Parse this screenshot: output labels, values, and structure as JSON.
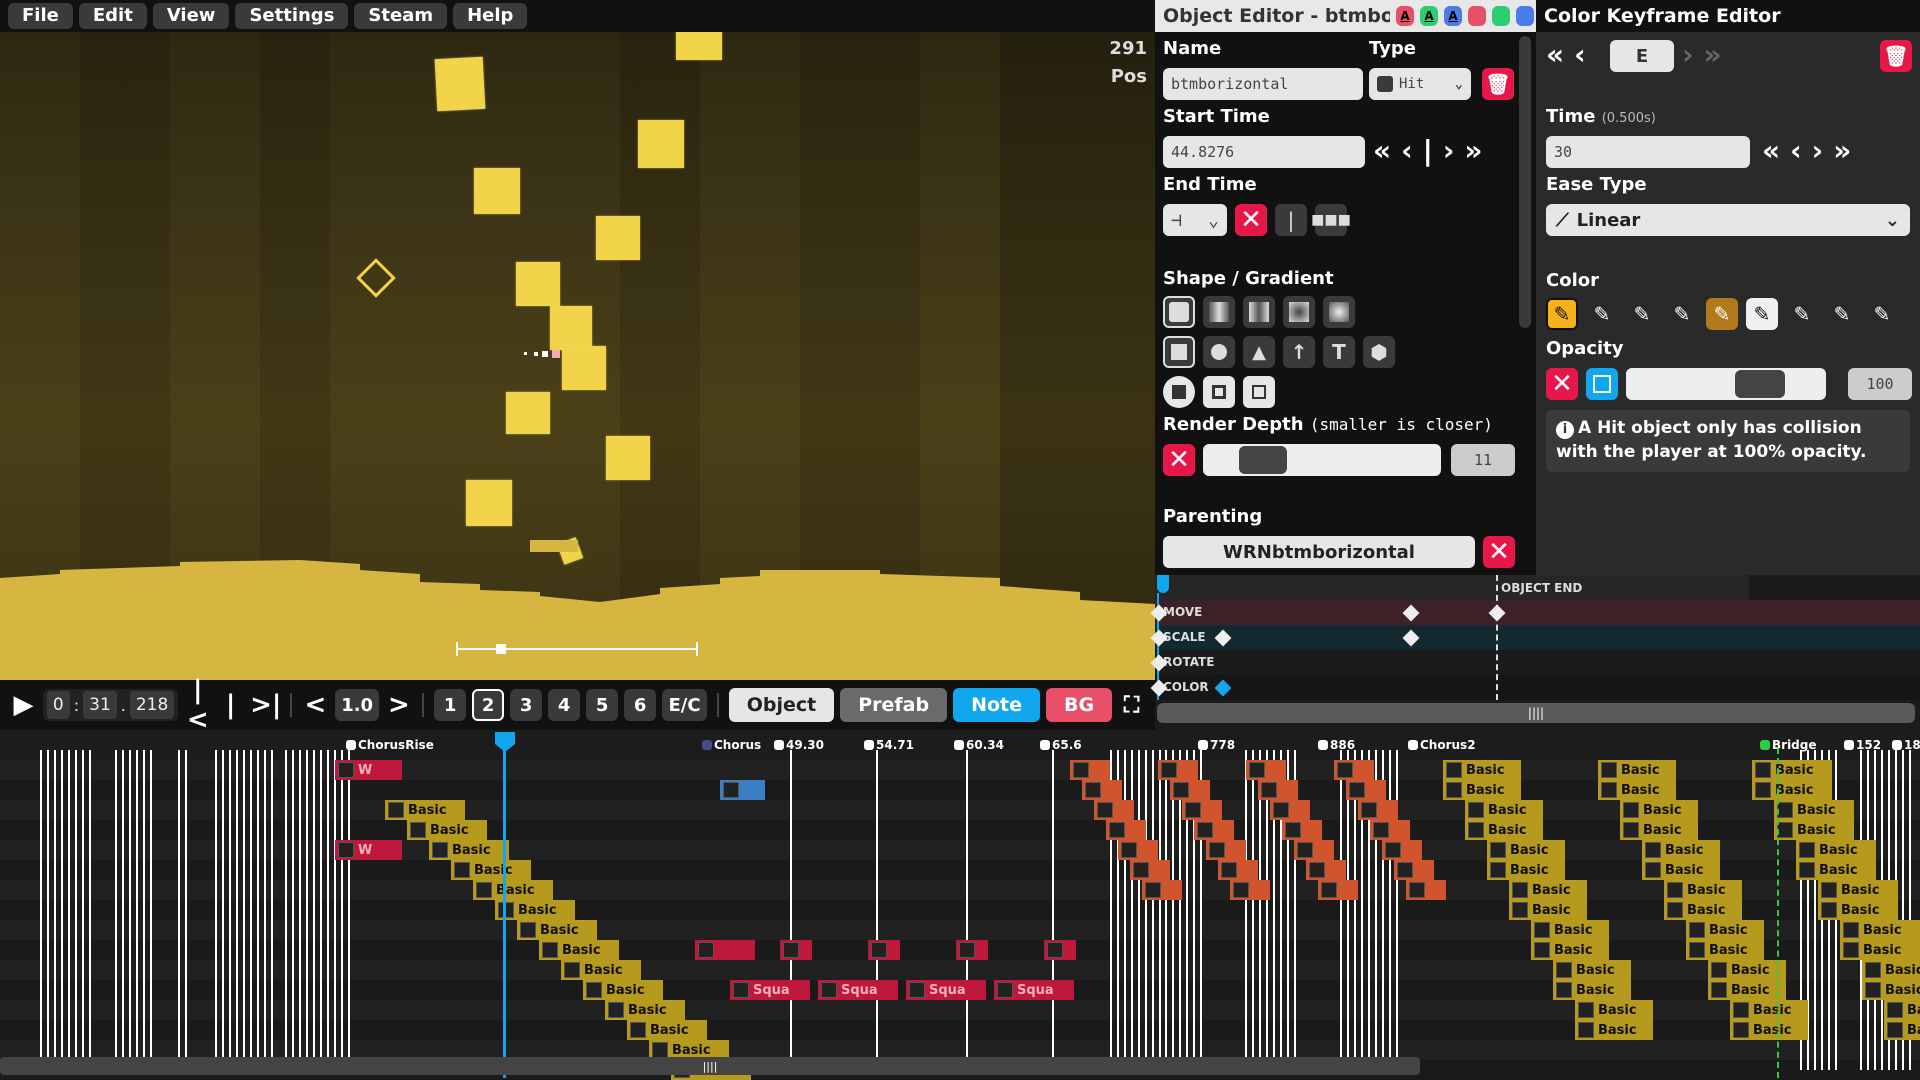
{
  "menu": [
    "File",
    "Edit",
    "View",
    "Settings",
    "Steam",
    "Help"
  ],
  "viewport": {
    "top_right_value": "291",
    "top_right_label": "Pos",
    "colors": {
      "object": "#f2d44a",
      "background": "#3d3516"
    }
  },
  "playbar": {
    "play_icon": "play-icon",
    "time": {
      "minutes": "0",
      "seconds": "31",
      "millis": "218",
      "sep1": ":",
      "sep2": "."
    },
    "speed": "1.0",
    "layers": [
      "1",
      "2",
      "3",
      "4",
      "5",
      "6",
      "E/C"
    ],
    "active_layer": "2",
    "modes": [
      {
        "label": "Object",
        "color": "#e6e6e6",
        "text": "#222"
      },
      {
        "label": "Prefab",
        "color": "#6a6a6a",
        "text": "#fff"
      },
      {
        "label": "Note",
        "color": "#11a7ef",
        "text": "#fff"
      },
      {
        "label": "BG",
        "color": "#e8506a",
        "text": "#fff"
      }
    ]
  },
  "object_editor": {
    "title": "Object Editor - btmbori…",
    "name_label": "Name",
    "name_value": "btmborizontal",
    "type_label": "Type",
    "type_value": "Hit",
    "start_time_label": "Start Time",
    "start_time_value": "44.8276",
    "end_time_label": "End Time",
    "end_time_mode": "⊣",
    "shape_label": "Shape / Gradient",
    "render_depth_label": "Render Depth",
    "render_depth_hint": "(smaller is closer)",
    "render_depth_value": "11",
    "parenting_label": "Parenting",
    "parent_value": "WRNbtmborizontal",
    "theme_badges": [
      {
        "c": "#e8506a"
      },
      {
        "c": "#2ecc71"
      },
      {
        "c": "#4a7be8"
      }
    ],
    "theme_dots": [
      "#e8506a",
      "#2ecc71",
      "#4a7be8"
    ]
  },
  "color_keyframe_editor": {
    "title": "Color Keyframe Editor",
    "kf_value": "E",
    "time_label": "Time",
    "time_hint": "(0.500s)",
    "time_value": "30",
    "ease_label": "Ease Type",
    "ease_value": "Linear",
    "color_label": "Color",
    "swatches": [
      "#f5b21b",
      "#2a2a2a",
      "#2a2a2a",
      "#2a2a2a",
      "#b07a1a",
      "#f0f0f0",
      "#2a2a2a",
      "#2a2a2a",
      "#2a2a2a"
    ],
    "opacity_label": "Opacity",
    "opacity_value": "100",
    "opacity_fraction": 0.8,
    "info": "A Hit object only has collision with the player at 100% opacity."
  },
  "kf_timeline": {
    "end_label": "OBJECT END",
    "rows": [
      {
        "label": "MOVE",
        "color": "#3c2226"
      },
      {
        "label": "SCALE",
        "color": "#13282f"
      },
      {
        "label": "ROTATE",
        "color": "#1b1b1b"
      },
      {
        "label": "COLOR",
        "color": "#161616"
      }
    ]
  },
  "timeline": {
    "markers": [
      {
        "label": "ChorusRise",
        "color": "#fff"
      },
      {
        "label": "Chorus",
        "color": "#4a4a8a"
      },
      {
        "label": "49.30",
        "color": "#fff"
      },
      {
        "label": "54.71",
        "color": "#fff"
      },
      {
        "label": "60.34",
        "color": "#fff"
      },
      {
        "label": "65.6",
        "color": "#fff"
      },
      {
        "label": "778",
        "color": "#fff"
      },
      {
        "label": "886",
        "color": "#fff"
      },
      {
        "label": "Chorus2",
        "color": "#fff"
      },
      {
        "label": "Bridge",
        "color": "#2ecc40"
      },
      {
        "label": "152",
        "color": "#fff"
      },
      {
        "label": "18",
        "color": "#fff"
      }
    ],
    "object_label_basic": "Basic",
    "object_label_w": "W",
    "object_label_squa": "Squa",
    "colors": {
      "basic": "#b59a1e",
      "hit": "#c0183a",
      "orange": "#d0552e",
      "blue": "#3a7fc4",
      "playhead": "#11a7ef"
    }
  }
}
